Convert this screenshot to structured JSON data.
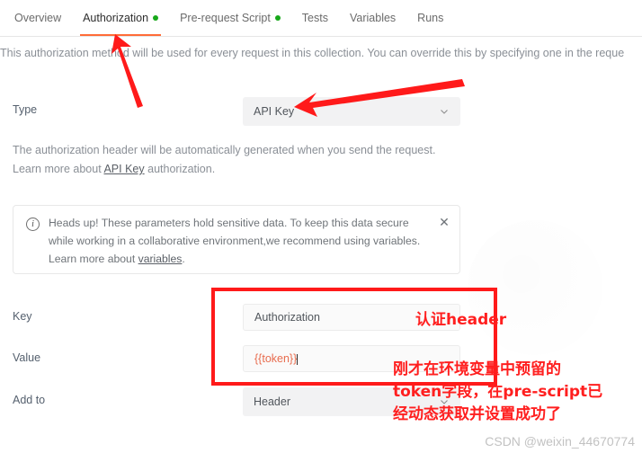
{
  "tabs": [
    {
      "label": "Overview",
      "active": false,
      "dot": false
    },
    {
      "label": "Authorization",
      "active": true,
      "dot": true
    },
    {
      "label": "Pre-request Script",
      "active": false,
      "dot": true
    },
    {
      "label": "Tests",
      "active": false,
      "dot": false
    },
    {
      "label": "Variables",
      "active": false,
      "dot": false
    },
    {
      "label": "Runs",
      "active": false,
      "dot": false
    }
  ],
  "description": "This authorization method will be used for every request in this collection. You can override this by specifying one in the reque",
  "form": {
    "type_label": "Type",
    "type_value": "API Key",
    "key_label": "Key",
    "key_value": "Authorization",
    "value_label": "Value",
    "value_value": "{{token}}",
    "addto_label": "Add to",
    "addto_value": "Header",
    "chevron": "∨"
  },
  "help": {
    "line1": "The authorization header will be automatically generated when you send the request.",
    "line2_pre": "Learn more about ",
    "line2_link": "API Key",
    "line2_post": " authorization."
  },
  "info": {
    "icon": "i",
    "line1": "Heads up! These parameters hold sensitive data. To keep this data secure",
    "line2": "while working in a collaborative environment,we recommend using variables.",
    "line3_pre": "Learn more about ",
    "line3_link": "variables",
    "line3_post": ".",
    "close": "✕"
  },
  "annotations": {
    "note_header": "认证header",
    "note_line1": "刚才在环境变量中预留的",
    "note_line2": "token字段，在pre-script已",
    "note_line3": "经动态获取并设置成功了",
    "color": "#ff1f1f"
  },
  "watermark": "CSDN @weixin_44670774",
  "colors": {
    "accent_orange": "#ff6c37",
    "dot_green": "#17a81a",
    "annotation_red": "#ff1a1a",
    "variable_orange": "#e86c4e"
  }
}
